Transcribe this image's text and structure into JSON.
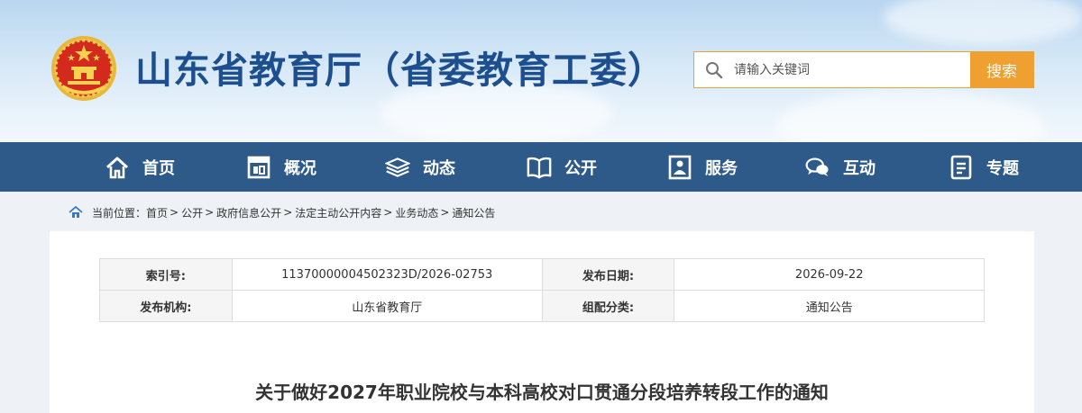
{
  "header": {
    "site_title": "山东省教育厅（省委教育工委）",
    "emblem_icon": "national-emblem-icon",
    "search": {
      "placeholder": "请输入关键词",
      "button_label": "搜索",
      "accent_color": "#f0a030"
    }
  },
  "nav": {
    "background": "#2e5a8a",
    "items": [
      {
        "label": "首页",
        "icon": "home-icon"
      },
      {
        "label": "概况",
        "icon": "overview-icon"
      },
      {
        "label": "动态",
        "icon": "news-icon"
      },
      {
        "label": "公开",
        "icon": "book-icon"
      },
      {
        "label": "服务",
        "icon": "service-icon"
      },
      {
        "label": "互动",
        "icon": "chat-icon"
      },
      {
        "label": "专题",
        "icon": "document-icon"
      }
    ]
  },
  "breadcrumb": {
    "prefix": "当前位置：",
    "items": [
      "首页",
      "公开",
      "政府信息公开",
      "法定主动公开内容",
      "业务动态",
      "通知公告"
    ],
    "separator": ">"
  },
  "meta_table": {
    "index_label": "索引号:",
    "index_value": "11370000004502323D/2026-02753",
    "date_label": "发布日期:",
    "date_value": "2026-09-22",
    "org_label": "发布机构:",
    "org_value": "山东省教育厅",
    "category_label": "组配分类:",
    "category_value": "通知公告"
  },
  "document": {
    "title": "关于做好2027年职业院校与本科高校对口贯通分段培养转段工作的通知"
  }
}
